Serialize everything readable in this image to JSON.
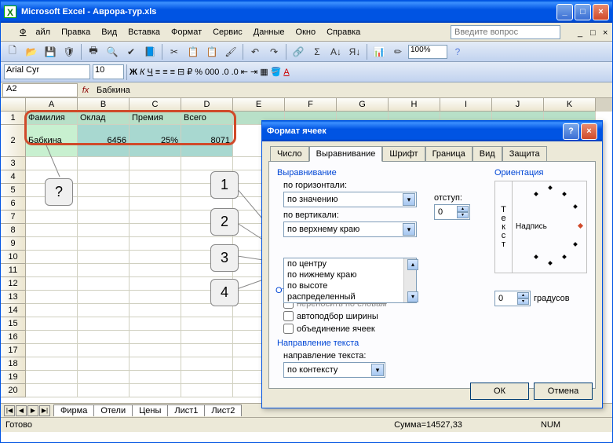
{
  "window": {
    "title": "Microsoft Excel - Аврора-тур.xls"
  },
  "menu": {
    "file": "Файл",
    "edit": "Правка",
    "view": "Вид",
    "insert": "Вставка",
    "format": "Формат",
    "tools": "Сервис",
    "data": "Данные",
    "window": "Окно",
    "help": "Справка",
    "question_ph": "Введите вопрос"
  },
  "toolbar": {
    "zoom": "100%"
  },
  "format_bar": {
    "font": "Arial Cyr",
    "size": "10"
  },
  "formula_bar": {
    "cell_ref": "A2",
    "value": "Бабкина"
  },
  "columns": [
    "A",
    "B",
    "C",
    "D",
    "E",
    "F",
    "G",
    "H",
    "I",
    "J",
    "K"
  ],
  "headers": {
    "A": "Фамилия",
    "B": "Оклад",
    "C": "Премия",
    "D": "Всего"
  },
  "row2": {
    "A": "Бабкина",
    "B": "6456",
    "C": "25%",
    "D": "8071"
  },
  "callouts": {
    "q": "?",
    "c1": "1",
    "c2": "2",
    "c3": "3",
    "c4": "4"
  },
  "sheets": {
    "s1": "Фирма",
    "s2": "Отели",
    "s3": "Цены",
    "s4": "Лист1",
    "s5": "Лист2"
  },
  "status": {
    "ready": "Готово",
    "sum": "Сумма=14527,33",
    "num": "NUM"
  },
  "dialog": {
    "title": "Формат ячеек",
    "tabs": {
      "t1": "Число",
      "t2": "Выравнивание",
      "t3": "Шрифт",
      "t4": "Граница",
      "t5": "Вид",
      "t6": "Защита"
    },
    "grp_align": "Выравнивание",
    "lbl_horiz": "по горизонтали:",
    "val_horiz": "по значению",
    "lbl_indent": "отступ:",
    "val_indent": "0",
    "lbl_vert": "по вертикали:",
    "val_vert": "по верхнему краю",
    "dd": {
      "o1": "по центру",
      "o2": "по нижнему краю",
      "o3": "по высоте",
      "o4": "распределенный"
    },
    "grp_display": "От",
    "chk_strike": "переносить по словам",
    "chk_auto": "автоподбор ширины",
    "chk_merge": "объединение ячеек",
    "grp_dir": "Направление текста",
    "lbl_dir": "направление текста:",
    "val_dir": "по контексту",
    "grp_orient": "Ориентация",
    "orient_vtext": "Текст",
    "orient_label": "Надпись",
    "val_deg": "0",
    "lbl_deg": "градусов",
    "ok": "ОК",
    "cancel": "Отмена"
  }
}
